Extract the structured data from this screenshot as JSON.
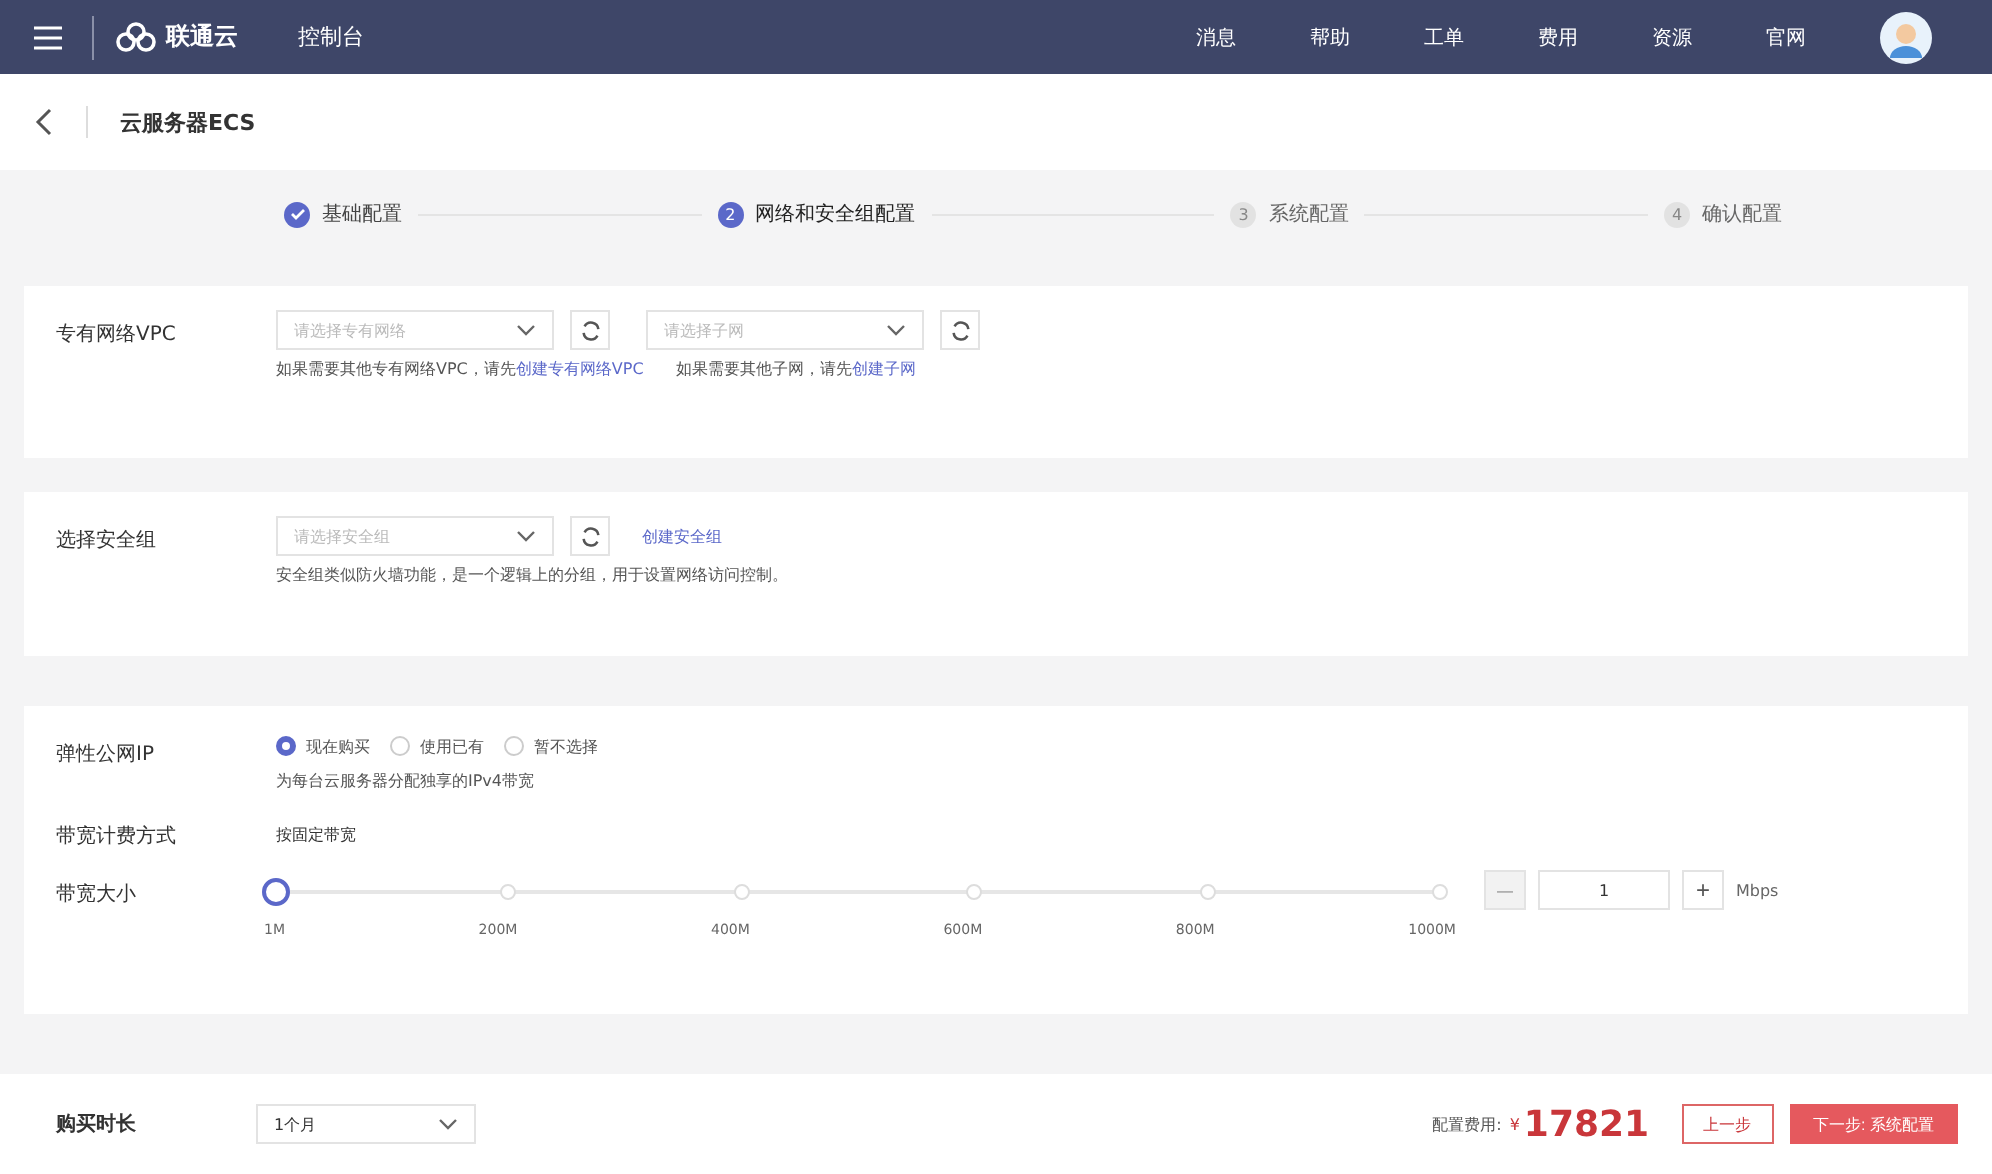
{
  "header": {
    "brand": "联通云",
    "console": "控制台",
    "nav": [
      "消息",
      "帮助",
      "工单",
      "费用",
      "资源",
      "官网"
    ]
  },
  "breadcrumb": {
    "title": "云服务器ECS"
  },
  "steps": [
    {
      "label": "基础配置",
      "done": true,
      "selected": false
    },
    {
      "number": "2",
      "label": "网络和安全组配置",
      "done": false,
      "selected": true
    },
    {
      "number": "3",
      "label": "系统配置",
      "done": false,
      "selected": false
    },
    {
      "number": "4",
      "label": "确认配置",
      "done": false,
      "selected": false
    }
  ],
  "vpc": {
    "label": "专有网络VPC",
    "vpc_placeholder": "请选择专有网络",
    "subnet_placeholder": "请选择子网",
    "hint1": "如果需要其他专有网络VPC，请先",
    "link1": "创建专有网络VPC",
    "hint2": "如果需要其他子网，请先",
    "link2": "创建子网"
  },
  "security": {
    "label": "选择安全组",
    "placeholder": "请选择安全组",
    "link": "创建安全组",
    "hint": "安全组类似防火墙功能，是一个逻辑上的分组，用于设置网络访问控制。"
  },
  "eip": {
    "label": "弹性公网IP",
    "options": [
      {
        "label": "现在购买",
        "selected": true
      },
      {
        "label": "使用已有",
        "selected": false
      },
      {
        "label": "暂不选择",
        "selected": false
      }
    ],
    "hint": "为每台云服务器分配独享的IPv4带宽"
  },
  "billing": {
    "label": "带宽计费方式",
    "value": "按固定带宽"
  },
  "bandwidth": {
    "label": "带宽大小",
    "level": 0,
    "ticks": [
      "1M",
      "200M",
      "400M",
      "600M",
      "800M",
      "1000M"
    ],
    "value": "1",
    "unit": "Mbps",
    "minus": "—",
    "plus": "+"
  },
  "footer": {
    "duration_label": "购买时长",
    "duration": "1个月",
    "cost_label": "配置费用:",
    "currency": "¥",
    "cost": "17821",
    "prev": "上一步",
    "next": "下一步: 系统配置"
  }
}
